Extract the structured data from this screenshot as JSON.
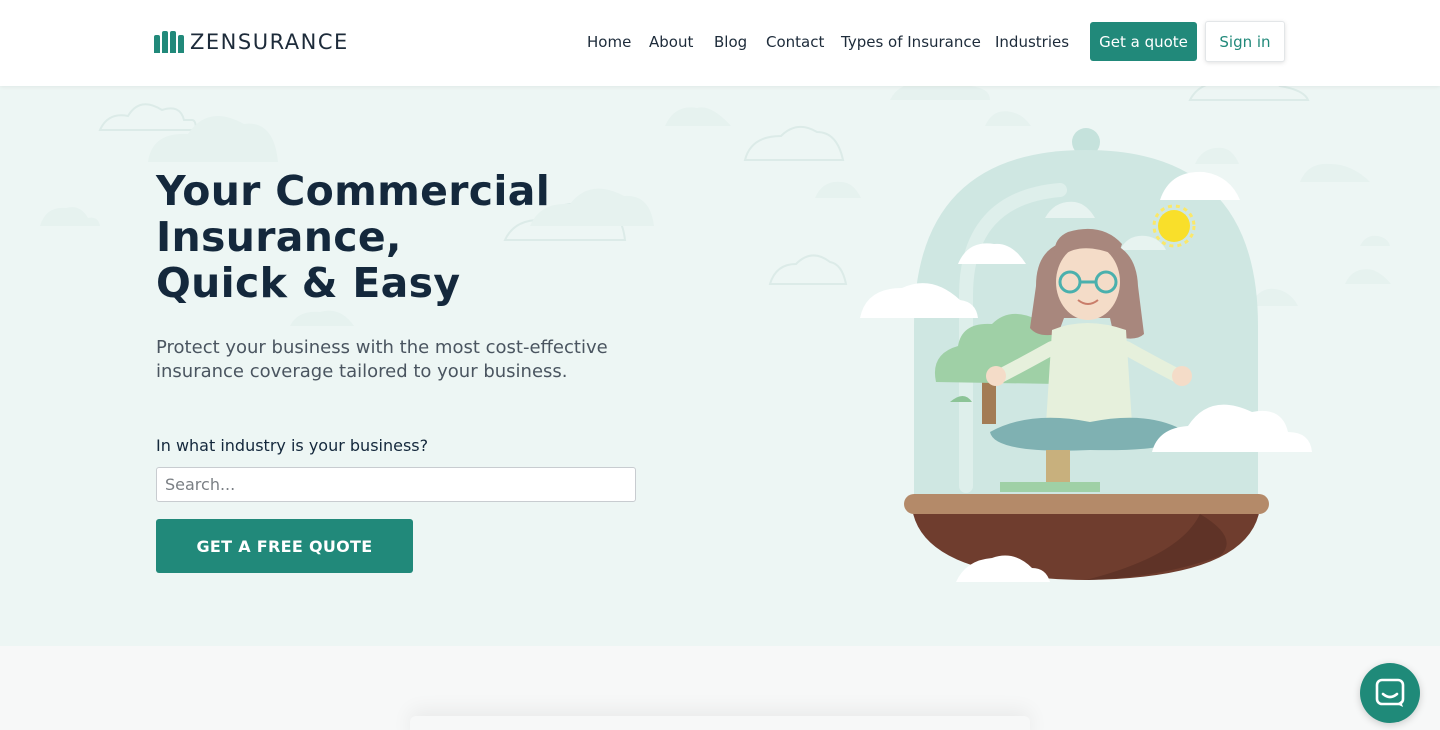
{
  "header": {
    "logo_text": "ZENSURANCE",
    "nav": [
      {
        "label": "Home"
      },
      {
        "label": "About"
      },
      {
        "label": "Blog"
      },
      {
        "label": "Contact"
      },
      {
        "label": "Types of Insurance"
      },
      {
        "label": "Industries"
      }
    ],
    "get_quote_label": "Get a quote",
    "sign_in_label": "Sign in"
  },
  "hero": {
    "title_lines": [
      "Your Commercial",
      "Insurance,",
      "Quick & Easy"
    ],
    "subtitle": "Protect your business with the most cost-effective insurance coverage tailored to your business.",
    "industry_question": "In what industry is your business?",
    "search_placeholder": "Search...",
    "search_value": "",
    "cta_label": "GET A FREE QUOTE"
  },
  "colors": {
    "brand": "#21897a",
    "hero_bg": "#edf6f4",
    "heading": "#14283c"
  },
  "icons": {
    "logo": "zensurance-logo-icon",
    "chat": "chat-icon"
  }
}
